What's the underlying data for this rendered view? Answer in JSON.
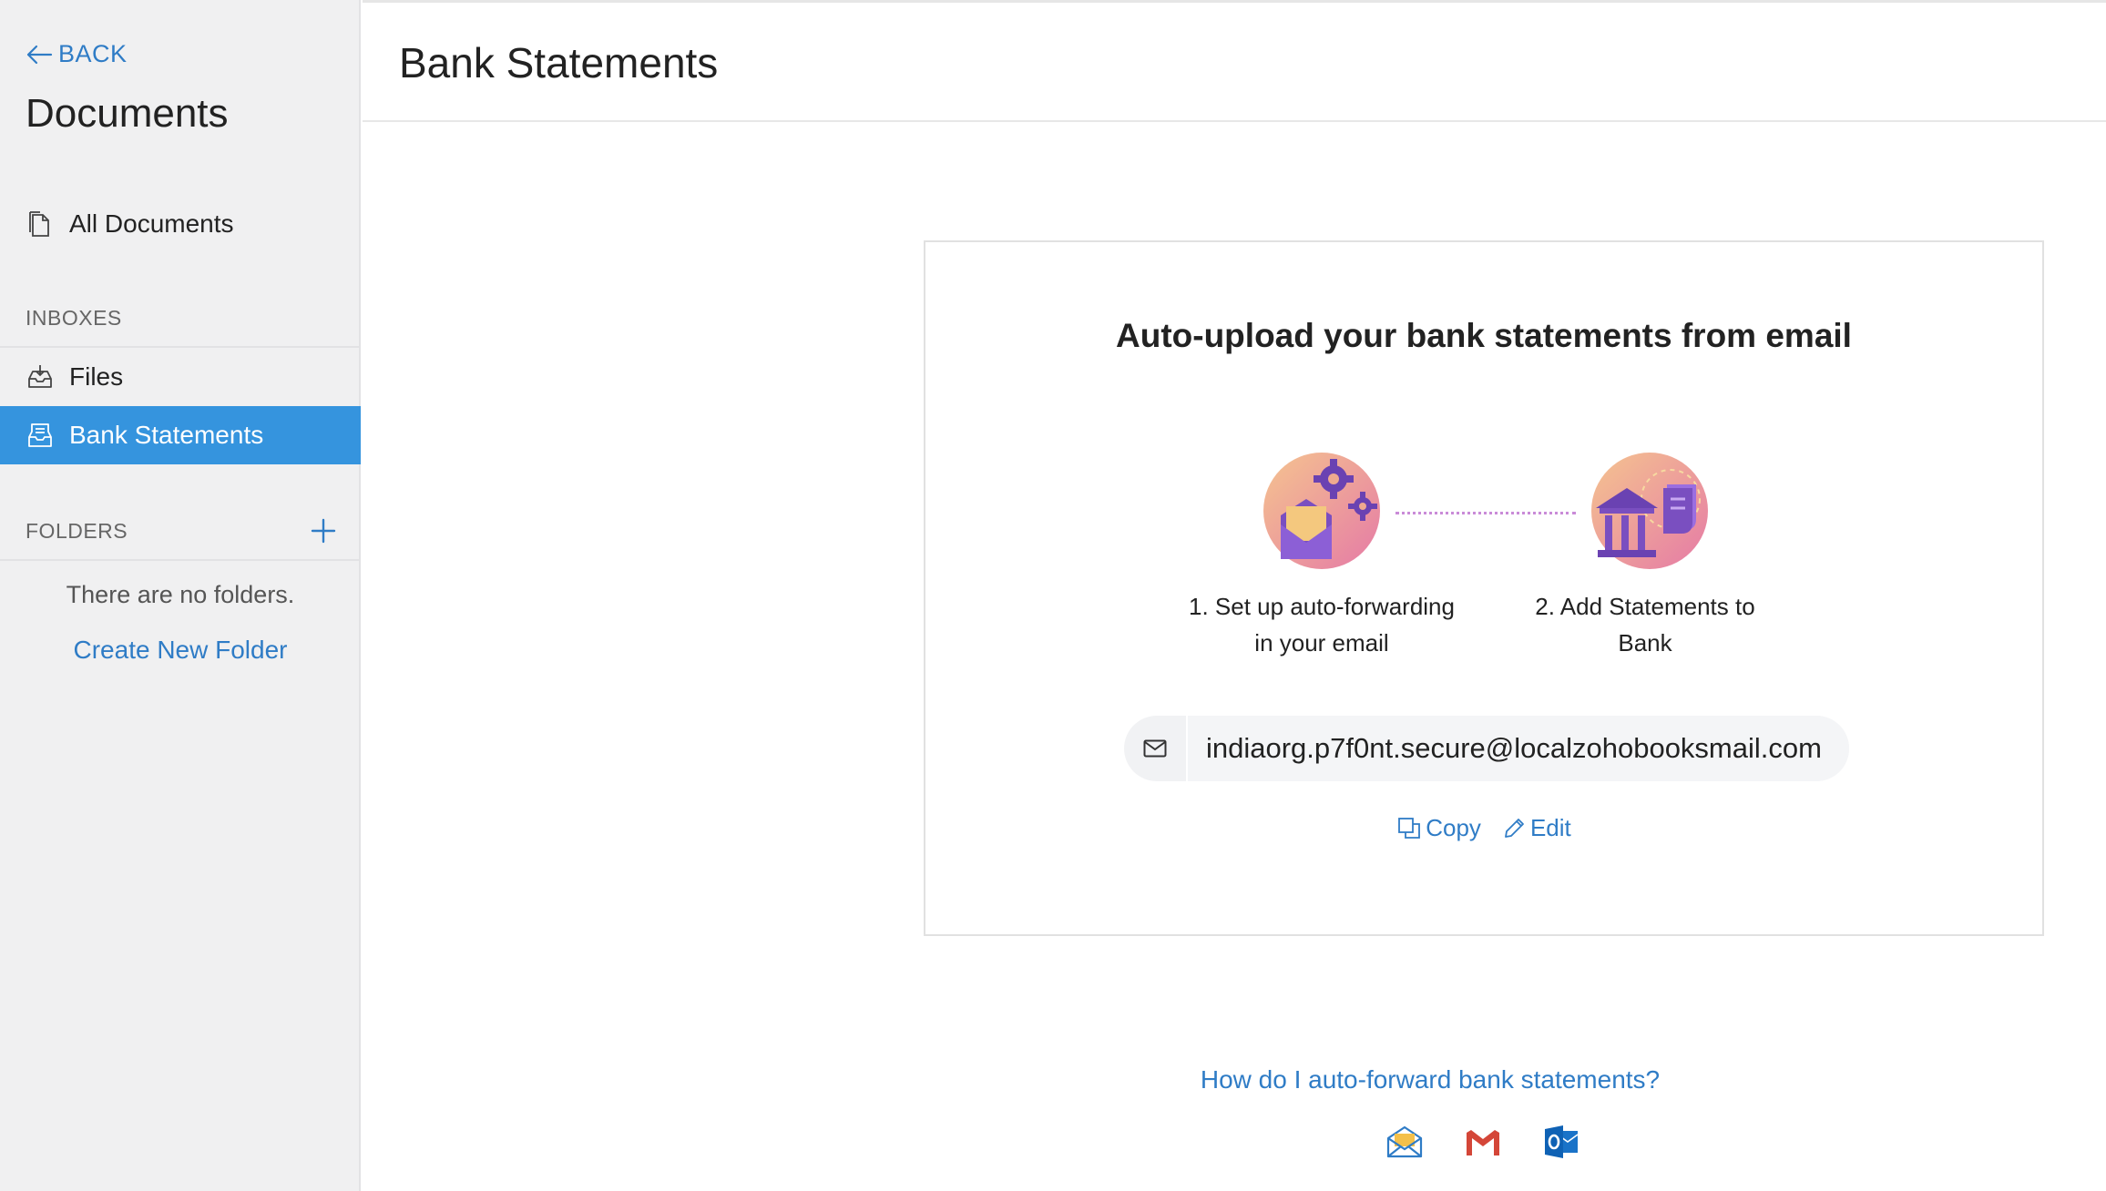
{
  "sidebar": {
    "back_label": "BACK",
    "title": "Documents",
    "all_documents_label": "All Documents",
    "inboxes_label": "INBOXES",
    "inbox_items": [
      {
        "label": "Files",
        "icon": "inbox-icon"
      },
      {
        "label": "Bank Statements",
        "icon": "statement-inbox-icon",
        "active": true
      }
    ],
    "folders_label": "FOLDERS",
    "no_folders_text": "There are no folders.",
    "create_folder_label": "Create New Folder"
  },
  "header": {
    "title": "Bank Statements"
  },
  "card": {
    "title": "Auto-upload your bank statements from email",
    "step1_line1": "1. Set up auto-forwarding",
    "step1_line2": "in your email",
    "step2_line1": "2. Add Statements to",
    "step2_line2": "Bank",
    "email": "indiaorg.p7f0nt.secure@localzohobooksmail.com",
    "copy_label": "Copy",
    "edit_label": "Edit"
  },
  "help": {
    "link_text": "How do I auto-forward bank statements?",
    "providers": [
      "generic-mail-icon",
      "gmail-icon",
      "outlook-icon"
    ]
  },
  "colors": {
    "accent": "#3594de",
    "link": "#2f7cc6",
    "sidebar_bg": "#f0f0f1"
  }
}
